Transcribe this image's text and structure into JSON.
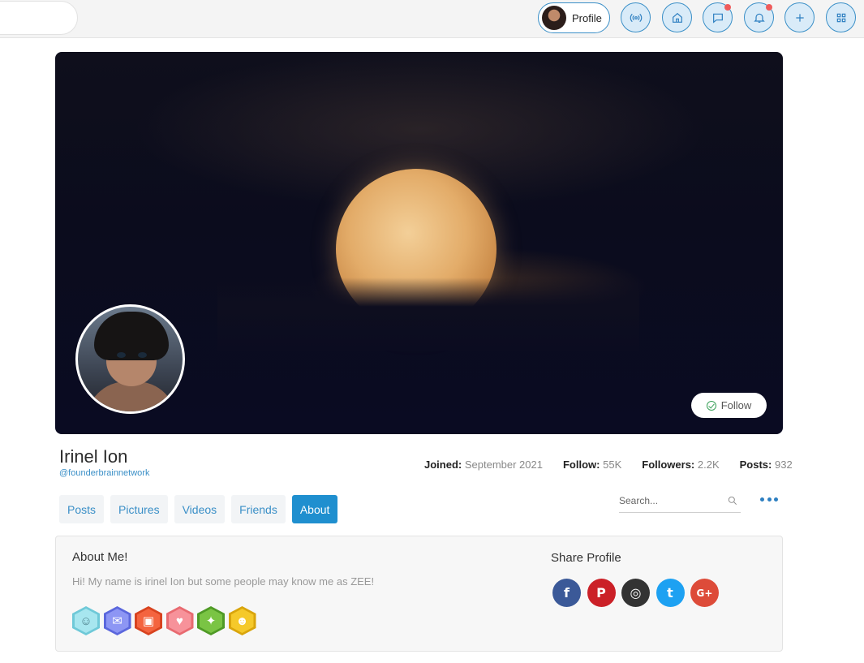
{
  "topbar": {
    "profile_label": "Profile",
    "buttons": [
      {
        "name": "live",
        "icon": "broadcast-icon",
        "badge": false
      },
      {
        "name": "home",
        "icon": "home-icon",
        "badge": false
      },
      {
        "name": "messages",
        "icon": "chat-icon",
        "badge": true
      },
      {
        "name": "notifications",
        "icon": "bell-icon",
        "badge": true
      },
      {
        "name": "create",
        "icon": "plus-icon",
        "badge": false
      },
      {
        "name": "apps",
        "icon": "grid-icon",
        "badge": false
      }
    ],
    "accent_color": "#3a8fc7",
    "badge_color": "#ef5b5b"
  },
  "cover": {
    "follow_label": "Follow"
  },
  "profile": {
    "name": "Irinel Ion",
    "handle": "@founderbrainnetwork",
    "stats": {
      "joined_label": "Joined:",
      "joined_value": "September 2021",
      "follow_label": "Follow:",
      "follow_value": "55K",
      "followers_label": "Followers:",
      "followers_value": "2.2K",
      "posts_label": "Posts:",
      "posts_value": "932"
    }
  },
  "tabs": [
    "Posts",
    "Pictures",
    "Videos",
    "Friends",
    "About"
  ],
  "active_tab": "About",
  "search": {
    "placeholder": "Search..."
  },
  "about": {
    "title": "About Me!",
    "text": "Hi! My name is irinel Ion but some people may know me as ZEE!",
    "badges": [
      {
        "icon": "user-badge-icon",
        "color": "#8fdce8"
      },
      {
        "icon": "mail-badge-icon",
        "color": "#7b85f0"
      },
      {
        "icon": "gift-badge-icon",
        "color": "#f25a3a"
      },
      {
        "icon": "heart-badge-icon",
        "color": "#f7868c"
      },
      {
        "icon": "wheat-badge-icon",
        "color": "#6cbb3c"
      },
      {
        "icon": "face-badge-icon",
        "color": "#f2c21a"
      }
    ]
  },
  "share": {
    "title": "Share Profile",
    "networks": [
      {
        "name": "facebook",
        "glyph": "f",
        "color": "#3b5998"
      },
      {
        "name": "pinterest",
        "glyph": "P",
        "color": "#cb2027"
      },
      {
        "name": "instagram",
        "glyph": "◎",
        "color": "#333333"
      },
      {
        "name": "twitter",
        "glyph": "t",
        "color": "#1da1f2"
      },
      {
        "name": "google-plus",
        "glyph": "G+",
        "color": "#dd4b39"
      }
    ]
  }
}
